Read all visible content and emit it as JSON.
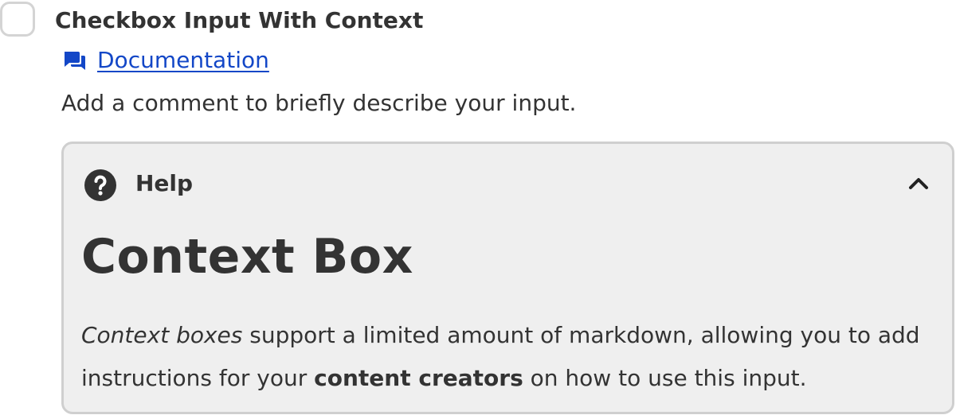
{
  "field": {
    "label": "Checkbox Input With Context",
    "documentation_link": "Documentation",
    "description": "Add a comment to briefly describe your input."
  },
  "context_box": {
    "header_label": "Help",
    "title": "Context Box",
    "body": {
      "part1_italic": "Context boxes",
      "part2": " support a limited amount of markdown, allowing you to add instructions for your ",
      "part3_bold": "content creators",
      "part4": " on how to use this input."
    }
  },
  "icons": {
    "documentation": "chat-bubbles-icon",
    "help": "question-circle-icon",
    "collapse": "chevron-up-icon"
  },
  "colors": {
    "link": "#1347c7",
    "box_background": "#efefef",
    "box_border": "#cfcfcf",
    "text": "#333333"
  }
}
